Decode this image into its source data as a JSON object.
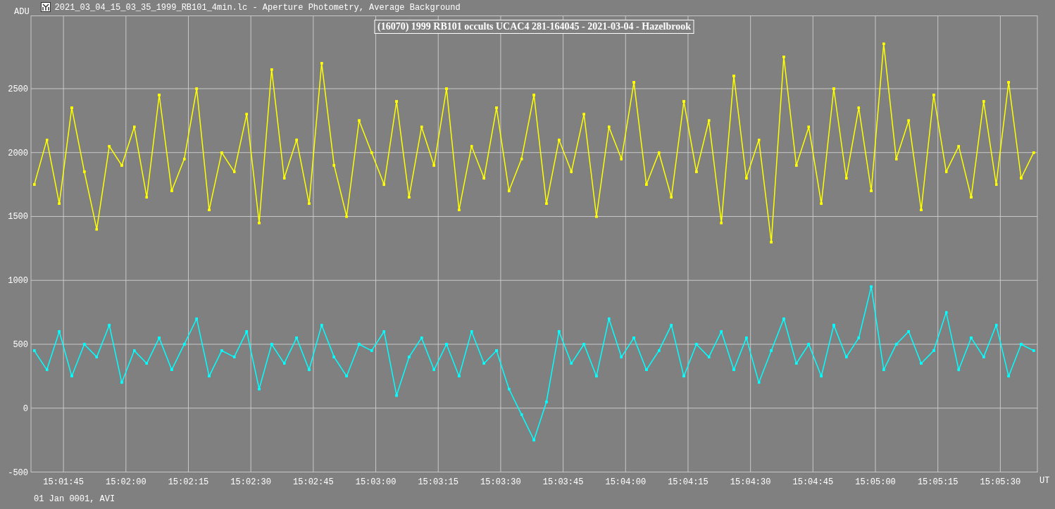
{
  "window": {
    "title": "2021_03_04_15_03_35_1999_RB101_4min.lc - Aperture Photometry, Average Background"
  },
  "chart": {
    "chart_data": {
      "type": "line",
      "grid": true,
      "title": "(16070) 1999 RB101 occults UCAC4 281-164045 - 2021-03-04 - Hazelbrook",
      "ylabel": "ADU",
      "xlabel": "UT",
      "x": [
        54098,
        54101,
        54104,
        54107,
        54110,
        54113,
        54116,
        54119,
        54122,
        54125,
        54128,
        54131,
        54134,
        54137,
        54140,
        54143,
        54146,
        54149,
        54152,
        54155,
        54158,
        54161,
        54164,
        54167,
        54170,
        54173,
        54176,
        54179,
        54182,
        54185,
        54188,
        54191,
        54194,
        54197,
        54200,
        54203,
        54206,
        54209,
        54212,
        54215,
        54218,
        54221,
        54224,
        54227,
        54230,
        54233,
        54236,
        54239,
        54242,
        54245,
        54248,
        54251,
        54254,
        54257,
        54260,
        54263,
        54266,
        54269,
        54272,
        54275,
        54278,
        54281,
        54284,
        54287,
        54290,
        54293,
        54296,
        54299,
        54302,
        54305,
        54308,
        54311,
        54314,
        54317,
        54320,
        54323,
        54326,
        54329,
        54332,
        54335,
        54338
      ],
      "series": [
        {
          "color": "#ffff00",
          "values": [
            1750,
            2100,
            1600,
            2350,
            1850,
            1400,
            2050,
            1900,
            2200,
            1650,
            2450,
            1700,
            1950,
            2500,
            1550,
            2000,
            1850,
            2300,
            1450,
            2650,
            1800,
            2100,
            1600,
            2700,
            1900,
            1500,
            2250,
            2000,
            1750,
            2400,
            1650,
            2200,
            1900,
            2500,
            1550,
            2050,
            1800,
            2350,
            1700,
            1950,
            2450,
            1600,
            2100,
            1850,
            2300,
            1500,
            2200,
            1950,
            2550,
            1750,
            2000,
            1650,
            2400,
            1850,
            2250,
            1450,
            2600,
            1800,
            2100,
            1300,
            2750,
            1900,
            2200,
            1600,
            2500,
            1800,
            2350,
            1700,
            2850,
            1950,
            2250,
            1550,
            2450,
            1850,
            2050,
            1650,
            2400,
            1750,
            2550,
            1800,
            2000
          ]
        },
        {
          "color": "#00ffff",
          "values": [
            450,
            300,
            600,
            250,
            500,
            400,
            650,
            200,
            450,
            350,
            550,
            300,
            500,
            700,
            250,
            450,
            400,
            600,
            150,
            500,
            350,
            550,
            300,
            650,
            400,
            250,
            500,
            450,
            600,
            100,
            400,
            550,
            300,
            500,
            250,
            600,
            350,
            450,
            150,
            -50,
            -250,
            50,
            600,
            350,
            500,
            250,
            700,
            400,
            550,
            300,
            450,
            650,
            250,
            500,
            400,
            600,
            300,
            550,
            200,
            450,
            700,
            350,
            500,
            250,
            650,
            400,
            550,
            950,
            300,
            500,
            600,
            350,
            450,
            750,
            300,
            550,
            400,
            650,
            250,
            500,
            450
          ]
        }
      ],
      "xlim": [
        54097.2,
        54338.9
      ],
      "ylim": [
        -500,
        3070
      ],
      "xticks": [
        {
          "value": 54105,
          "label": "15:01:45"
        },
        {
          "value": 54120,
          "label": "15:02:00"
        },
        {
          "value": 54135,
          "label": "15:02:15"
        },
        {
          "value": 54150,
          "label": "15:02:30"
        },
        {
          "value": 54165,
          "label": "15:02:45"
        },
        {
          "value": 54180,
          "label": "15:03:00"
        },
        {
          "value": 54195,
          "label": "15:03:15"
        },
        {
          "value": 54210,
          "label": "15:03:30"
        },
        {
          "value": 54225,
          "label": "15:03:45"
        },
        {
          "value": 54240,
          "label": "15:04:00"
        },
        {
          "value": 54255,
          "label": "15:04:15"
        },
        {
          "value": 54270,
          "label": "15:04:30"
        },
        {
          "value": 54285,
          "label": "15:04:45"
        },
        {
          "value": 54300,
          "label": "15:05:00"
        },
        {
          "value": 54315,
          "label": "15:05:15"
        },
        {
          "value": 54330,
          "label": "15:05:30"
        }
      ],
      "yticks": [
        -500,
        0,
        500,
        1000,
        1500,
        2000,
        2500
      ]
    }
  },
  "status_bar": {
    "text": "01 Jan 0001, AVI"
  }
}
